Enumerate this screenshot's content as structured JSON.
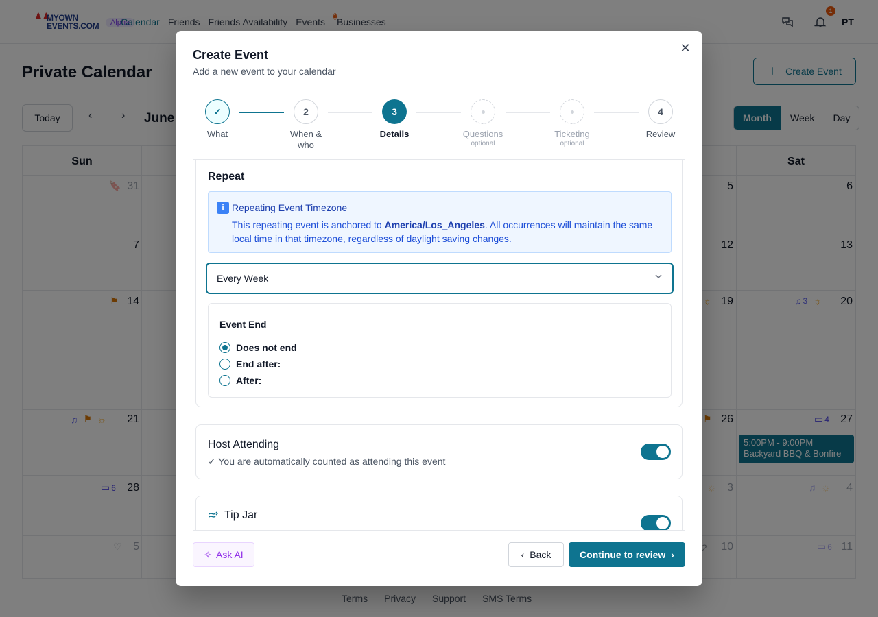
{
  "nav": {
    "logo_text": "MYOWN EVENTS.COM",
    "alpha_badge": "Alpha",
    "links": [
      "Calendar",
      "Friends",
      "Friends Availability",
      "Events",
      "Businesses"
    ],
    "events_count": "1",
    "notification_count": "1",
    "avatar_initials": "PT"
  },
  "page": {
    "title": "Private Calendar",
    "create_event_label": "Create Event",
    "today_label": "Today",
    "month_label": "June",
    "views": [
      "Month",
      "Week",
      "Day"
    ],
    "selected_view": "Month",
    "day_headers": {
      "sun": "Sun",
      "sat": "Sat"
    },
    "dates": {
      "r0_sun": "31",
      "r0_fri": "5",
      "r0_sat": "6",
      "r1_sun": "7",
      "r1_fri": "12",
      "r1_sat": "13",
      "r2_sun": "14",
      "r2_fri": "19",
      "r2_sat": "20",
      "r3_sun": "21",
      "r3_fri": "26",
      "r3_sat": "27",
      "r4_sun": "28",
      "r4_fri": "3",
      "r4_sat": "4",
      "r5_sun": "5",
      "r5_fri": "10",
      "r5_sat": "11"
    },
    "counts": {
      "r2_sat_music": "3",
      "r3_sat_bag": "4",
      "r4_sun_bag": "6",
      "r5_fri": "2",
      "r5_sat": "6"
    },
    "event_chip": {
      "time": "5:00PM - 9:00PM",
      "title": "Backyard BBQ & Bonfire"
    },
    "footer_links": [
      "Terms",
      "Privacy",
      "Support",
      "SMS Terms"
    ]
  },
  "modal": {
    "title": "Create Event",
    "subtitle": "Add a new event to your calendar",
    "steps": [
      {
        "label": "What",
        "number": ""
      },
      {
        "label": "When & who",
        "number": "2"
      },
      {
        "label": "Details",
        "number": "3"
      },
      {
        "label": "Questions",
        "number": "",
        "note": "optional"
      },
      {
        "label": "Ticketing",
        "number": "",
        "note": "optional"
      },
      {
        "label": "Review",
        "number": "4"
      }
    ],
    "repeat": {
      "title": "Repeat",
      "tz_title": "Repeating Event Timezone",
      "tz_text_before": "This repeating event is anchored to ",
      "tz_zone": "America/Los_Angeles",
      "tz_text_after": ". All occurrences will maintain the same local time in that timezone, regardless of daylight saving changes.",
      "frequency_value": "Every Week",
      "event_end_title": "Event End",
      "end_options": [
        "Does not end",
        "End after:",
        "After:"
      ],
      "selected_end_option": "Does not end"
    },
    "host": {
      "title": "Host Attending",
      "description": "✓ You are automatically counted as attending this event",
      "enabled": true
    },
    "tip_jar": {
      "title": "Tip Jar",
      "enabled": true
    },
    "footer": {
      "ask_ai": "Ask AI",
      "back": "Back",
      "continue": "Continue to review"
    }
  },
  "colors": {
    "accent": "#0e7490",
    "info_bg": "#eff6ff",
    "ai_purple": "#9333ea",
    "badge_orange": "#ea580c"
  }
}
